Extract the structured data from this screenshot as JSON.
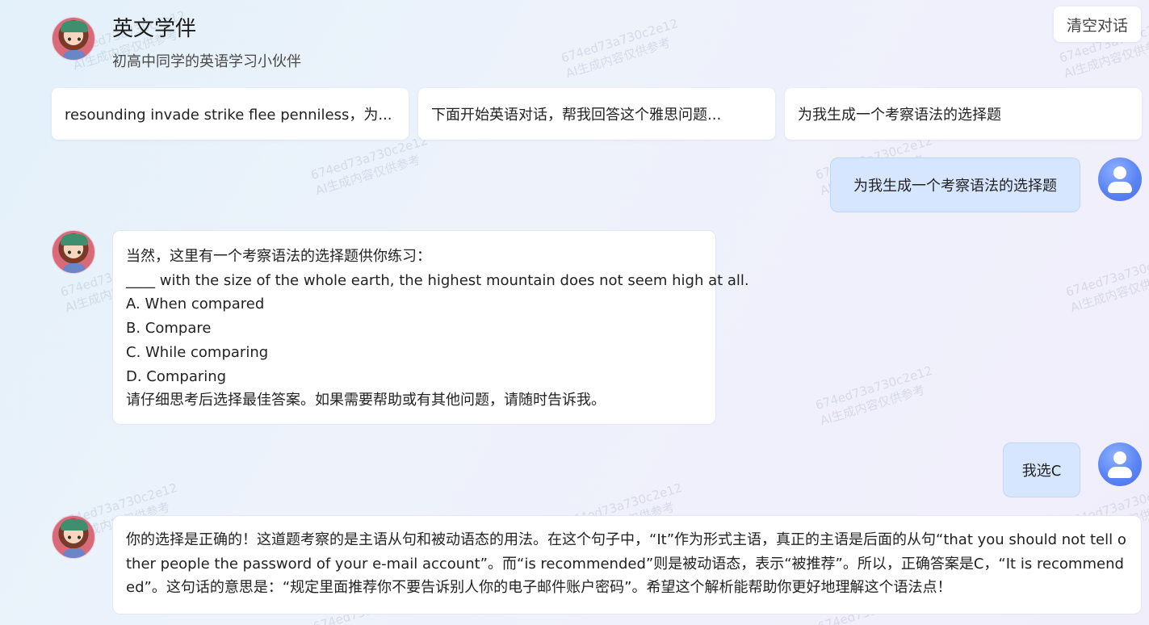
{
  "header": {
    "title": "英文学伴",
    "subtitle": "初高中同学的英语学习小伙伴",
    "clear_button": "清空对话"
  },
  "suggestions": [
    "resounding invade strike flee penniless，为...",
    "下面开始英语对话，帮我回答这个雅思问题...",
    "为我生成一个考察语法的选择题"
  ],
  "messages": {
    "m1_user": "为我生成一个考察语法的选择题",
    "m2_bot": {
      "lines": [
        "当然，这里有一个考察语法的选择题供你练习：",
        "____ with the size of the whole earth, the highest mountain does not seem high at all.",
        "A. When compared",
        "B. Compare",
        "C. While comparing",
        "D. Comparing",
        "请仔细思考后选择最佳答案。如果需要帮助或有其他问题，请随时告诉我。"
      ]
    },
    "m3_user": "我选C",
    "m4_bot": "你的选择是正确的！这道题考察的是主语从句和被动语态的用法。在这个句子中，“It”作为形式主语，真正的主语是后面的从句“that you should not tell other people the password of your e-mail account”。而“is recommended”则是被动语态，表示“被推荐”。所以，正确答案是C，“It is recommended”。这句话的意思是：“规定里面推荐你不要告诉别人你的电子邮件账户密码”。希望这个解析能帮助你更好地理解这个语法点！"
  },
  "watermark": {
    "line1": "674ed73a730c2e12",
    "line2": "AI生成内容仅供参考"
  },
  "colors": {
    "user_bubble": "#d6e6ff",
    "user_avatar": "#5b85f5",
    "bot_bubble": "#ffffff"
  }
}
